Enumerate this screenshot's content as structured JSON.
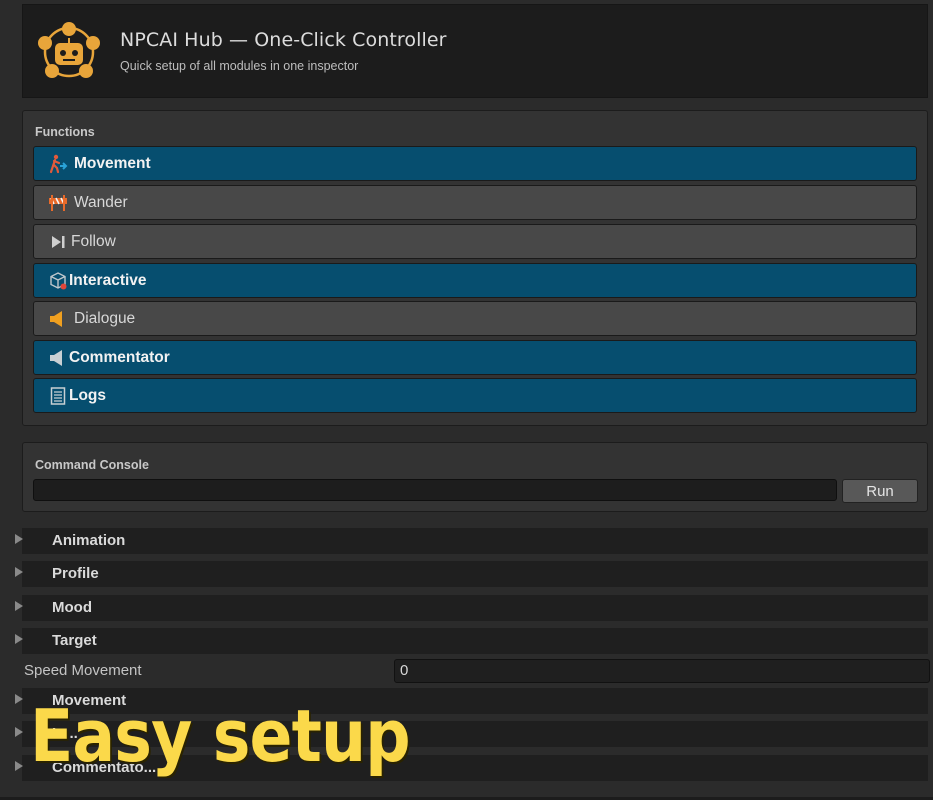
{
  "header": {
    "title": "NPCAI Hub — One-Click Controller",
    "subtitle": "Quick setup of all modules in one inspector",
    "logo_icon": "robot-hub-icon"
  },
  "functions": {
    "label": "Functions",
    "items": [
      {
        "label": "Movement",
        "active": true,
        "icon": "running-person-icon"
      },
      {
        "label": "Wander",
        "active": false,
        "icon": "barrier-icon"
      },
      {
        "label": "Follow",
        "active": false,
        "icon": "skip-forward-icon"
      },
      {
        "label": "Interactive",
        "active": true,
        "icon": "cube-icon"
      },
      {
        "label": "Dialogue",
        "active": false,
        "icon": "speaker-icon"
      },
      {
        "label": "Commentator",
        "active": true,
        "icon": "speaker-icon"
      },
      {
        "label": "Logs",
        "active": true,
        "icon": "document-icon"
      }
    ]
  },
  "console": {
    "label": "Command Console",
    "input_value": "",
    "run_label": "Run"
  },
  "foldouts": [
    {
      "label": "Animation"
    },
    {
      "label": "Profile"
    },
    {
      "label": "Mood"
    },
    {
      "label": "Target"
    }
  ],
  "speed_field": {
    "label": "Speed Movement",
    "value": "0"
  },
  "foldouts_lower": [
    {
      "label": "Movement"
    },
    {
      "label": "In..."
    },
    {
      "label": "Commentato..."
    }
  ],
  "overlay": {
    "text": "Easy setup"
  },
  "colors": {
    "active_button": "#064e6f",
    "inactive_button": "#484848",
    "accent_yellow": "#fbd94a"
  }
}
